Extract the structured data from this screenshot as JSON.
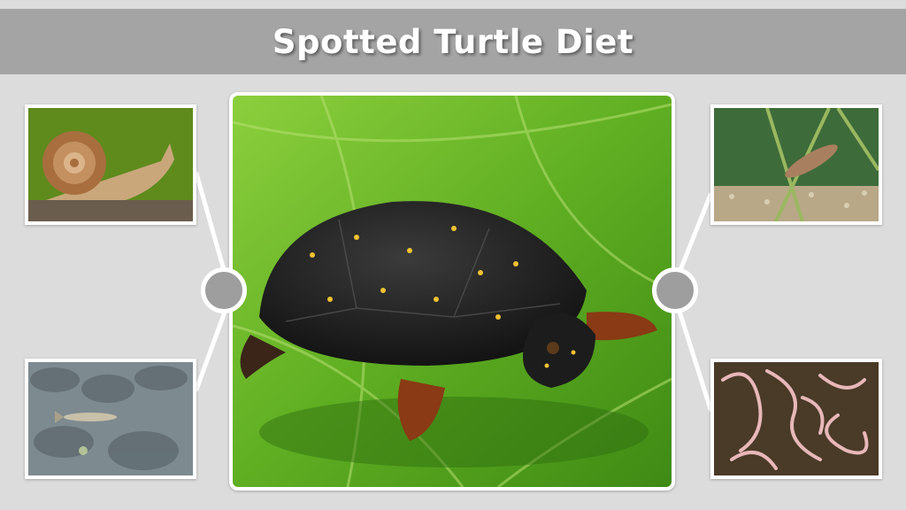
{
  "header": {
    "title": "Spotted Turtle Diet"
  },
  "colors": {
    "background": "#dcdcdc",
    "title_bar": "#a4a4a4",
    "title_text": "#ffffff",
    "hub": "#9e9e9e",
    "connector": "#ffffff"
  },
  "photos": {
    "center": "spotted-turtle-on-leaf",
    "top_left": "snail",
    "bottom_left": "minnow-fish",
    "top_right": "aquatic-insect-larva",
    "bottom_right": "worms"
  }
}
